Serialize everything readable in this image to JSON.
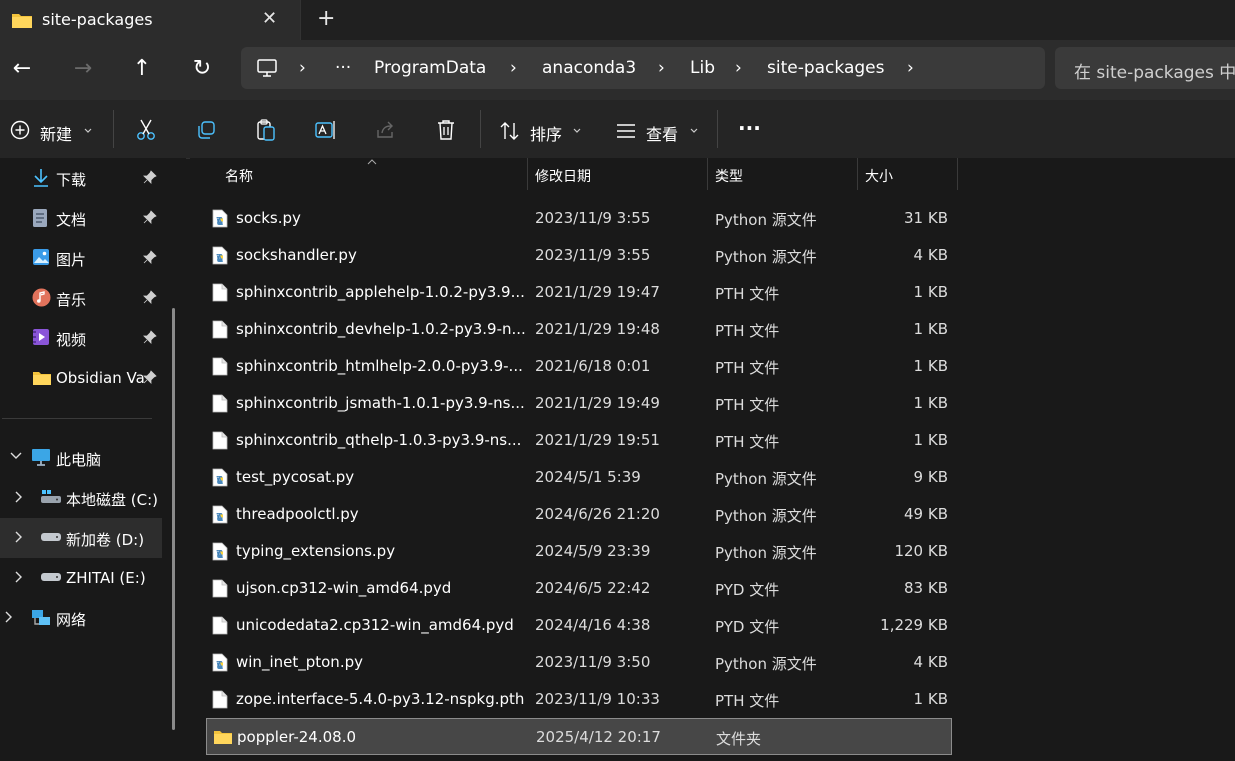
{
  "tab": {
    "title": "site-packages",
    "close_glyph": "✕",
    "new_glyph": "+"
  },
  "nav": {
    "back_glyph": "←",
    "forward_glyph": "→",
    "up_glyph": "↑",
    "refresh_glyph": "↻",
    "more_glyph": "···",
    "breadcrumbs": [
      "ProgramData",
      "anaconda3",
      "Lib",
      "site-packages"
    ],
    "sep_glyph": "›",
    "search_placeholder": "在 site-packages 中搜索"
  },
  "toolbar": {
    "new_label": "新建",
    "sort_label": "排序",
    "view_label": "查看",
    "more_glyph": "···"
  },
  "sidebar": {
    "quick": [
      {
        "label": "下载",
        "icon": "download-icon"
      },
      {
        "label": "文档",
        "icon": "document-icon"
      },
      {
        "label": "图片",
        "icon": "picture-icon"
      },
      {
        "label": "音乐",
        "icon": "music-icon"
      },
      {
        "label": "视频",
        "icon": "video-icon"
      },
      {
        "label": "Obsidian Va",
        "icon": "folder-icon"
      }
    ],
    "this_pc": "此电脑",
    "drives": [
      {
        "label": "本地磁盘 (C:)"
      },
      {
        "label": "新加卷 (D:)"
      },
      {
        "label": "ZHITAI (E:)"
      }
    ],
    "network": "网络"
  },
  "columns": {
    "name": "名称",
    "modified": "修改日期",
    "type": "类型",
    "size": "大小"
  },
  "files": [
    {
      "name": "socks.py",
      "date": "2023/11/9 3:55",
      "type": "Python 源文件",
      "size": "31 KB",
      "kind": "py"
    },
    {
      "name": "sockshandler.py",
      "date": "2023/11/9 3:55",
      "type": "Python 源文件",
      "size": "4 KB",
      "kind": "py"
    },
    {
      "name": "sphinxcontrib_applehelp-1.0.2-py3.9...",
      "date": "2021/1/29 19:47",
      "type": "PTH 文件",
      "size": "1 KB",
      "kind": "doc"
    },
    {
      "name": "sphinxcontrib_devhelp-1.0.2-py3.9-n...",
      "date": "2021/1/29 19:48",
      "type": "PTH 文件",
      "size": "1 KB",
      "kind": "doc"
    },
    {
      "name": "sphinxcontrib_htmlhelp-2.0.0-py3.9-...",
      "date": "2021/6/18 0:01",
      "type": "PTH 文件",
      "size": "1 KB",
      "kind": "doc"
    },
    {
      "name": "sphinxcontrib_jsmath-1.0.1-py3.9-ns...",
      "date": "2021/1/29 19:49",
      "type": "PTH 文件",
      "size": "1 KB",
      "kind": "doc"
    },
    {
      "name": "sphinxcontrib_qthelp-1.0.3-py3.9-ns...",
      "date": "2021/1/29 19:51",
      "type": "PTH 文件",
      "size": "1 KB",
      "kind": "doc"
    },
    {
      "name": "test_pycosat.py",
      "date": "2024/5/1 5:39",
      "type": "Python 源文件",
      "size": "9 KB",
      "kind": "py"
    },
    {
      "name": "threadpoolctl.py",
      "date": "2024/6/26 21:20",
      "type": "Python 源文件",
      "size": "49 KB",
      "kind": "py"
    },
    {
      "name": "typing_extensions.py",
      "date": "2024/5/9 23:39",
      "type": "Python 源文件",
      "size": "120 KB",
      "kind": "py"
    },
    {
      "name": "ujson.cp312-win_amd64.pyd",
      "date": "2024/6/5 22:42",
      "type": "PYD 文件",
      "size": "83 KB",
      "kind": "doc"
    },
    {
      "name": "unicodedata2.cp312-win_amd64.pyd",
      "date": "2024/4/16 4:38",
      "type": "PYD 文件",
      "size": "1,229 KB",
      "kind": "doc"
    },
    {
      "name": "win_inet_pton.py",
      "date": "2023/11/9 3:50",
      "type": "Python 源文件",
      "size": "4 KB",
      "kind": "py"
    },
    {
      "name": "zope.interface-5.4.0-py3.12-nspkg.pth",
      "date": "2023/11/9 10:33",
      "type": "PTH 文件",
      "size": "1 KB",
      "kind": "doc"
    },
    {
      "name": "poppler-24.08.0",
      "date": "2025/4/12 20:17",
      "type": "文件夹",
      "size": "",
      "kind": "folder",
      "selected": true
    }
  ],
  "colors": {
    "folder": "#f3c33c",
    "accent": "#4cc2ff"
  }
}
